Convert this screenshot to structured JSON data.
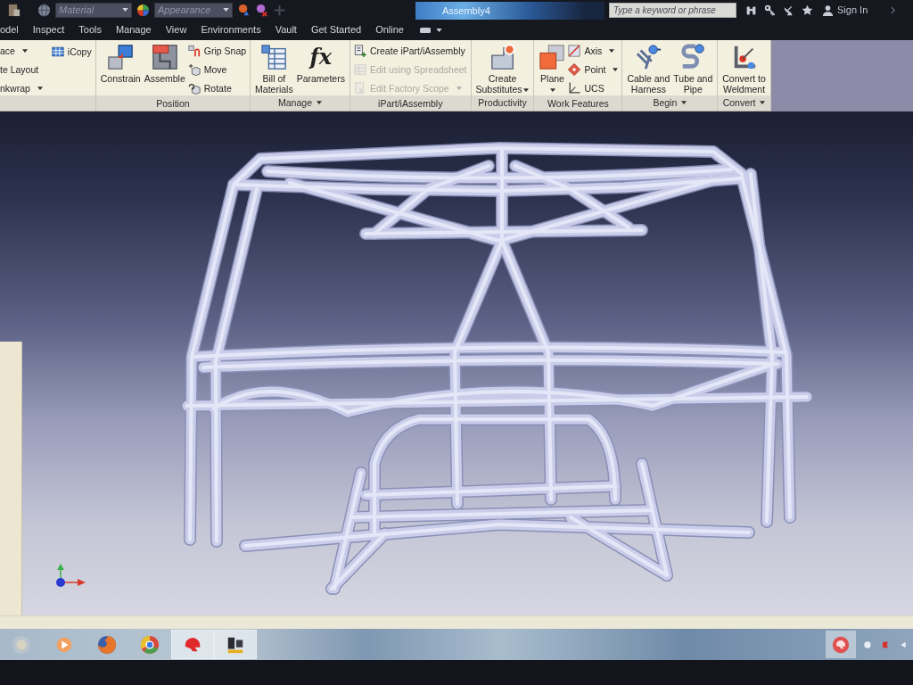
{
  "title_bar": {
    "quick_access": {
      "material": {
        "value": "Material"
      },
      "appearance": {
        "value": "Appearance"
      }
    },
    "document_title": "Assembly4",
    "search": {
      "placeholder": "Type a keyword or phrase"
    },
    "sign_in": "Sign In"
  },
  "tabs": [
    {
      "label": "odel",
      "selected": false
    },
    {
      "label": "Inspect",
      "selected": false
    },
    {
      "label": "Tools",
      "selected": false
    },
    {
      "label": "Manage",
      "selected": false
    },
    {
      "label": "View",
      "selected": false
    },
    {
      "label": "Environments",
      "selected": false
    },
    {
      "label": "Vault",
      "selected": false
    },
    {
      "label": "Get Started",
      "selected": false
    },
    {
      "label": "Online",
      "selected": false
    }
  ],
  "ribbon": {
    "panels": [
      {
        "menu": false,
        "tools": [
          {
            "kind": "small",
            "label": "ace",
            "dropdown": true,
            "disabled": false
          },
          {
            "kind": "small",
            "label": "te Layout",
            "dropdown": false,
            "disabled": false
          },
          {
            "kind": "small",
            "label": "nkwrap",
            "dropdown": true,
            "disabled": false
          },
          {
            "kind": "small",
            "label": "iCopy",
            "dropdown": false,
            "disabled": false
          }
        ]
      },
      {
        "title": "Position",
        "menu": false,
        "tools": [
          {
            "kind": "large",
            "label": "Constrain",
            "dropdown": false,
            "disabled": false
          },
          {
            "kind": "large",
            "label": "Assemble",
            "dropdown": false,
            "disabled": false
          },
          {
            "kind": "small",
            "label": "Grip Snap",
            "dropdown": false,
            "disabled": false
          },
          {
            "kind": "small",
            "label": "Move",
            "dropdown": false,
            "disabled": false
          },
          {
            "kind": "small",
            "label": "Rotate",
            "dropdown": false,
            "disabled": false
          }
        ]
      },
      {
        "title": "Manage",
        "menu": true,
        "tools": [
          {
            "kind": "large",
            "label": "Bill of Materials",
            "dropdown": false,
            "disabled": false
          },
          {
            "kind": "large",
            "label": "Parameters",
            "icon_text": "fx",
            "dropdown": false,
            "disabled": false
          }
        ]
      },
      {
        "title": "iPart/iAssembly",
        "menu": false,
        "tools": [
          {
            "kind": "small",
            "label": "Create iPart/iAssembly",
            "dropdown": false,
            "disabled": false
          },
          {
            "kind": "small",
            "label": "Edit using Spreadsheet",
            "dropdown": false,
            "disabled": true
          },
          {
            "kind": "small",
            "label": "Edit Factory Scope",
            "dropdown": true,
            "disabled": true
          }
        ]
      },
      {
        "title": "Productivity",
        "menu": false,
        "tools": [
          {
            "kind": "large",
            "label": "Create Substitutes",
            "dropdown": true,
            "disabled": false
          }
        ]
      },
      {
        "title": "Work Features",
        "menu": false,
        "tools": [
          {
            "kind": "large",
            "label": "Plane",
            "dropdown": true,
            "disabled": false
          },
          {
            "kind": "small",
            "label": "Axis",
            "dropdown": true,
            "disabled": false
          },
          {
            "kind": "small",
            "label": "Point",
            "dropdown": true,
            "disabled": false
          },
          {
            "kind": "small",
            "label": "UCS",
            "dropdown": false,
            "disabled": false
          }
        ]
      },
      {
        "title": "Begin",
        "menu": true,
        "tools": [
          {
            "kind": "large",
            "label": "Cable and Harness",
            "dropdown": false,
            "disabled": false
          },
          {
            "kind": "large",
            "label": "Tube and Pipe",
            "dropdown": false,
            "disabled": false
          }
        ]
      },
      {
        "title": "Convert",
        "menu": true,
        "tools": [
          {
            "kind": "large",
            "label": "Convert to Weldment",
            "dropdown": false,
            "disabled": false
          }
        ]
      }
    ]
  },
  "taskbar": {
    "apps": [
      {
        "kind": "start",
        "active": false
      },
      {
        "kind": "play",
        "active": false
      },
      {
        "kind": "fox",
        "active": false
      },
      {
        "kind": "ring",
        "active": false
      },
      {
        "kind": "helmet",
        "active": true
      },
      {
        "kind": "blocks",
        "active": true
      }
    ],
    "tray": [
      {
        "kind": "helmet",
        "active": true
      },
      {
        "kind": "dot",
        "active": false
      },
      {
        "kind": "flag",
        "active": false
      },
      {
        "kind": "arrow",
        "active": false
      }
    ]
  }
}
